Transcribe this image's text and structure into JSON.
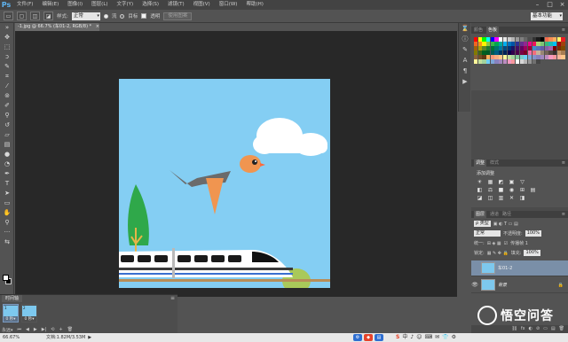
{
  "app": {
    "logo": "Ps"
  },
  "menu": [
    "文件(F)",
    "编辑(E)",
    "图像(I)",
    "图层(L)",
    "文字(Y)",
    "选择(S)",
    "滤镜(T)",
    "视图(V)",
    "窗口(W)",
    "帮助(H)"
  ],
  "window_controls": [
    "–",
    "□",
    "×"
  ],
  "options": {
    "feather_label": "羽化:",
    "style_label": "样式:",
    "mode_value": "正常",
    "radio_1": "流",
    "radio_2": "目标",
    "checkbox_label": "透明",
    "disabled_button": "使用图案",
    "workspace": "基本功能"
  },
  "document": {
    "tab_title": "-1.jpg @ 66.7% (车01-2, RGB/8) *",
    "tab_close": "×"
  },
  "timeline": {
    "title": "时间轴",
    "frames": [
      {
        "number": "1",
        "delay": "0 秒▾"
      },
      {
        "number": "2",
        "delay": "0 秒▾"
      }
    ],
    "loop": "永远▾",
    "controls": [
      "⏮",
      "◀",
      "▶",
      "▶|",
      "⟲",
      "+",
      "🗑"
    ]
  },
  "status": {
    "zoom": "66.67%",
    "doc_size": "文档:1.82M/3.53M",
    "arrow": "▶"
  },
  "taskbar": {
    "ime_main": "中",
    "icons": [
      "S",
      "中",
      "♪",
      "☺",
      "⌨",
      "✉",
      "👕",
      "⚙"
    ]
  },
  "panels": {
    "swatches_tabs": [
      "颜色",
      "色板"
    ],
    "swatch_colors": [
      "#ff0000",
      "#ffff00",
      "#00ff00",
      "#00ffff",
      "#0000ff",
      "#ff00ff",
      "#ffffff",
      "#e6e6e6",
      "#cccccc",
      "#b3b3b3",
      "#999999",
      "#808080",
      "#666666",
      "#4d4d4d",
      "#333333",
      "#1a1a1a",
      "#000000",
      "#f26c4f",
      "#f68e55",
      "#fbaf5c",
      "#fff467",
      "#ed1c24",
      "#f26522",
      "#f7941d",
      "#fff200",
      "#8dc63f",
      "#39b54a",
      "#00a651",
      "#00a99d",
      "#00aeef",
      "#0072bc",
      "#0054a6",
      "#2e3192",
      "#662d91",
      "#92278f",
      "#ec008c",
      "#ed145b",
      "#acd372",
      "#7cc576",
      "#3bb878",
      "#1abbb4",
      "#00bff3",
      "#9e0b0f",
      "#a0410d",
      "#a36209",
      "#aba000",
      "#598527",
      "#1a7b30",
      "#007236",
      "#00746b",
      "#0076a3",
      "#004b80",
      "#003471",
      "#1b1464",
      "#440e62",
      "#630460",
      "#9e005d",
      "#9e0039",
      "#438ccb",
      "#5674b9",
      "#605ca8",
      "#8560a8",
      "#a763a8",
      "#790000",
      "#7b2e00",
      "#7d4900",
      "#827b00",
      "#406618",
      "#005e20",
      "#005826",
      "#005952",
      "#005b7f",
      "#003663",
      "#002157",
      "#0d004c",
      "#32004b",
      "#4b0049",
      "#7b0046",
      "#7a0026",
      "#f06eaa",
      "#f26d7d",
      "#c7b299",
      "#998675",
      "#736357",
      "#534741",
      "#37302d",
      "#c69c6d",
      "#a67c52",
      "#8c6239",
      "#754c24",
      "#603913",
      "#fbaf5c",
      "#f7977a",
      "#f9ad81",
      "#fdc68a",
      "#fff79a",
      "#c4df9b",
      "#a3d39c",
      "#82ca9c",
      "#7accc8",
      "#6dcff6",
      "#7da7d9",
      "#8393ca",
      "#8781bd",
      "#a187be",
      "#bd8cbf",
      "#f49ac1",
      "#f5989d",
      "#fab49b",
      "#fdc689",
      "#fff799",
      "#c4df9a",
      "#a2d39c",
      "#6ecff6",
      "#7ea7d8",
      "#8882be",
      "#a286bd",
      "#bc8cbf",
      "#f39ac1",
      "#f6989d",
      "#ffffff",
      "#d7d7d7",
      "#b7b7b7",
      "#959595",
      "#707070",
      "#464646"
    ],
    "adjust_tabs": [
      "调整",
      "样式"
    ],
    "adjust_title": "添加调整",
    "adjust_row1": [
      "☀",
      "▦",
      "◩",
      "▣",
      "▽"
    ],
    "adjust_row2": [
      "◧",
      "⚖",
      "■",
      "◉",
      "⊞",
      "▤"
    ],
    "adjust_row3": [
      "◪",
      "◫",
      "▥",
      "✕",
      "◨"
    ],
    "layers_tabs": [
      "图层",
      "通道",
      "路径"
    ],
    "kind_label": "ρ 类型",
    "blend_mode": "正常",
    "opacity_label": "不透明度:",
    "opacity_value": "100%",
    "unify_label": "统一:",
    "propagate_label": "传播帧 1",
    "lock_label": "锁定:",
    "fill_label": "填充:",
    "fill_value": "100%",
    "layers": [
      {
        "name": "车01-2",
        "visible": false,
        "selected": true
      },
      {
        "name": "背景",
        "visible": true,
        "selected": false
      }
    ],
    "footer_icons": [
      "⛓",
      "fx",
      "◐",
      "⊘",
      "▭",
      "▤",
      "🗑"
    ]
  },
  "watermark": {
    "text": "悟空问答"
  }
}
